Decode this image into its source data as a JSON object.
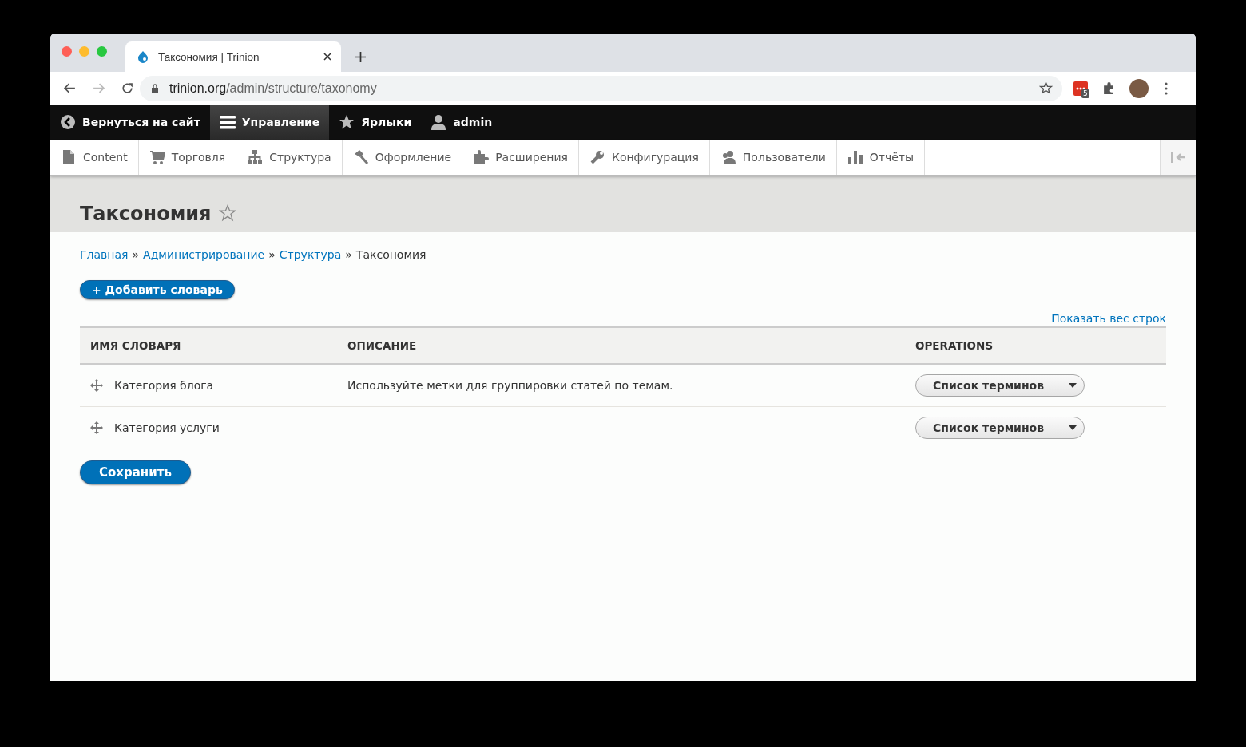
{
  "browser": {
    "tab_title": "Таксономия | Trinion",
    "url_host": "trinion.org",
    "url_path": "/admin/structure/taxonomy",
    "extension_badge": "5"
  },
  "toolbar": [
    {
      "label": "Вернуться на сайт",
      "kind": "back",
      "selected": false
    },
    {
      "label": "Управление",
      "kind": "menu",
      "selected": true
    },
    {
      "label": "Ярлыки",
      "kind": "star",
      "selected": false
    },
    {
      "label": "admin",
      "kind": "user",
      "selected": false
    }
  ],
  "tray": [
    {
      "label": "Content",
      "kind": "content"
    },
    {
      "label": "Торговля",
      "kind": "cart"
    },
    {
      "label": "Структура",
      "kind": "structure"
    },
    {
      "label": "Оформление",
      "kind": "appearance"
    },
    {
      "label": "Расширения",
      "kind": "extend"
    },
    {
      "label": "Конфигурация",
      "kind": "config"
    },
    {
      "label": "Пользователи",
      "kind": "people"
    },
    {
      "label": "Отчёты",
      "kind": "reports"
    }
  ],
  "page_title": "Таксономия",
  "breadcrumb": [
    {
      "label": "Главная",
      "link": true
    },
    {
      "label": "Администрирование",
      "link": true
    },
    {
      "label": "Структура",
      "link": true
    },
    {
      "label": "Таксономия",
      "link": false
    }
  ],
  "breadcrumb_separator": "»",
  "add_button": "+ Добавить словарь",
  "show_weights_link": "Показать вес строк",
  "table": {
    "columns": [
      "ИМЯ СЛОВАРЯ",
      "ОПИСАНИЕ",
      "OPERATIONS"
    ],
    "rows": [
      {
        "name": "Категория блога",
        "description": "Используйте метки для группировки статей по темам.",
        "operation": "Список терминов"
      },
      {
        "name": "Категория услуги",
        "operation": "Список терминов"
      }
    ]
  },
  "save_button": "Сохранить"
}
